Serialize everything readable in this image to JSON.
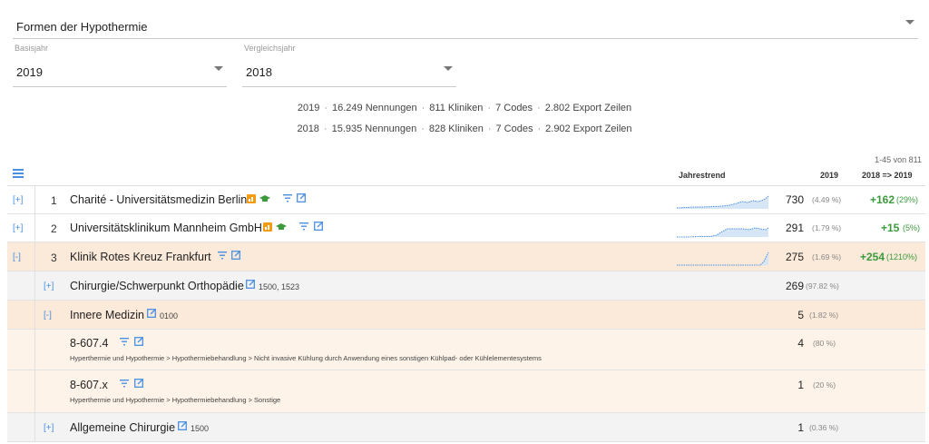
{
  "filter": {
    "value": "Formen der Hypothermie"
  },
  "base_year": {
    "label": "Basisjahr",
    "value": "2019"
  },
  "compare_year": {
    "label": "Vergleichsjahr",
    "value": "2018"
  },
  "summary": [
    {
      "year": "2019",
      "mentions": "16.249 Nennungen",
      "clinics": "811 Kliniken",
      "codes": "7 Codes",
      "export": "2.802 Export Zeilen"
    },
    {
      "year": "2018",
      "mentions": "15.935 Nennungen",
      "clinics": "828 Kliniken",
      "codes": "7 Codes",
      "export": "2.902 Export Zeilen"
    }
  ],
  "pagination": "1-45 von 811",
  "table_header": {
    "trend": "Jahrestrend",
    "year": "2019",
    "compare": "2018 => 2019"
  },
  "rows": [
    {
      "toggle": "[+]",
      "rank": "1",
      "name": "Charité - Universitätsmedizin Berlin",
      "value": "730",
      "pct": "(4.49 %)",
      "delta": "+162",
      "delta_pct": "(29%)"
    },
    {
      "toggle": "[+]",
      "rank": "2",
      "name": "Universitätsklinikum Mannheim GmbH",
      "value": "291",
      "pct": "(1.79 %)",
      "delta": "+15",
      "delta_pct": "(5%)"
    },
    {
      "toggle": "[-]",
      "rank": "3",
      "name": "Klinik Rotes Kreuz Frankfurt",
      "value": "275",
      "pct": "(1.69 %)",
      "delta": "+254",
      "delta_pct": "(1210%)"
    },
    {
      "toggle": "[+]",
      "name": "Chirurgie/Schwerpunkt Orthopädie",
      "code": "1500, 1523",
      "value": "269",
      "pct": "(97.82 %)"
    },
    {
      "toggle": "[-]",
      "name": "Innere Medizin",
      "code": "0100",
      "value": "5",
      "pct": "(1.82 %)"
    },
    {
      "name": "8-607.4",
      "path": "Hyperthermie und Hypothermie > Hypothermiebehandlung > Nicht invasive Kühlung durch Anwendung eines sonstigen Kühlpad- oder Kühlelementesystems",
      "value": "4",
      "pct": "(80 %)"
    },
    {
      "name": "8-607.x",
      "path": "Hyperthermie und Hypothermie > Hypothermiebehandlung > Sonstige",
      "value": "1",
      "pct": "(20 %)"
    },
    {
      "toggle": "[+]",
      "name": "Allgemeine Chirurgie",
      "code": "1500",
      "value": "1",
      "pct": "(0.36 %)"
    }
  ],
  "colors": {
    "accent": "#4a90e2",
    "positive": "#3c9a3c",
    "highlight": "#fbe9d9",
    "badge_orange": "#f39c12",
    "badge_green": "#3c9a3c"
  },
  "icons": [
    "menu-icon",
    "filter-icon",
    "external-link-icon",
    "bar-chart-badge-icon",
    "graduation-cap-icon",
    "chevron-down-icon"
  ]
}
